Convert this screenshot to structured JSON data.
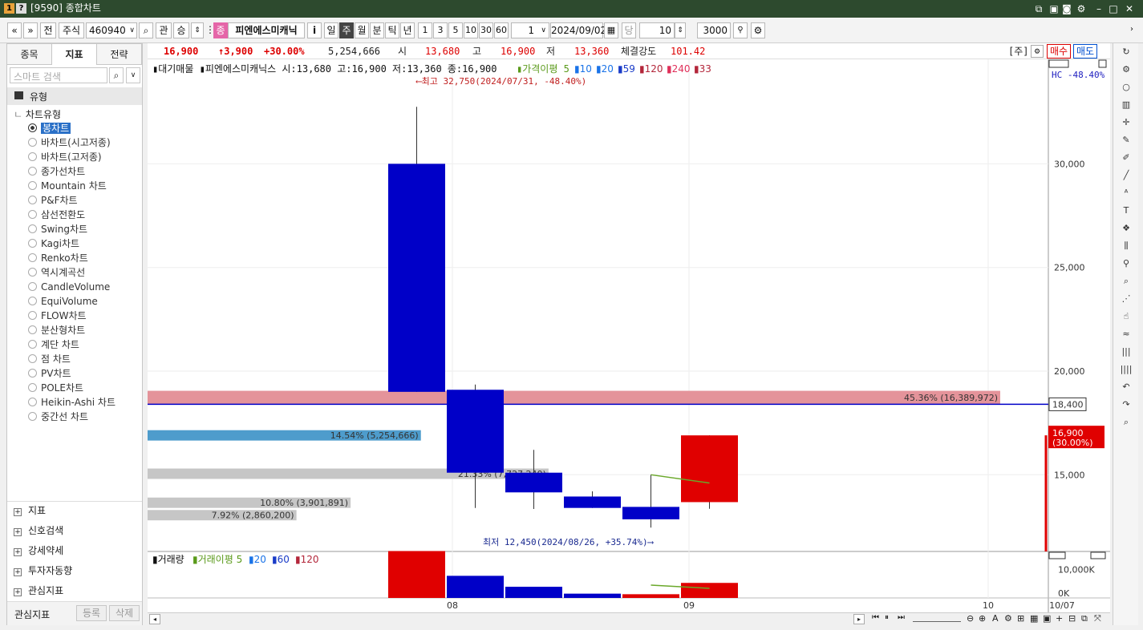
{
  "window": {
    "badge1": "1",
    "badge2": "?",
    "title": "[9590] 종합차트"
  },
  "toolbar": {
    "prev": "«",
    "next": "»",
    "jeon": "전",
    "market": "주식",
    "code": "460940",
    "search_icon": "search-icon",
    "gwan": "관",
    "seung": "승",
    "name_tag": "종",
    "name": "피엔에스미캐닉",
    "info": "i",
    "periods": [
      "일",
      "주",
      "월",
      "분",
      "틱",
      "년"
    ],
    "active_period": "주",
    "intervals": [
      "1",
      "3",
      "5",
      "10",
      "30",
      "60"
    ],
    "unit_value": "1",
    "date": "2024/09/02",
    "dang": "당",
    "count": "10",
    "slash": "/",
    "total": "3000"
  },
  "left_panel": {
    "tabs": [
      "종목",
      "지표",
      "전략"
    ],
    "active_tab": "지표",
    "search_placeholder": "스마트 검색",
    "section": "유형",
    "group": "차트유형",
    "chart_types": [
      "봉차트",
      "바차트(시고저종)",
      "바차트(고저종)",
      "종가선차트",
      "Mountain 차트",
      "P&F차트",
      "삼선전환도",
      "Swing차트",
      "Kagi차트",
      "Renko차트",
      "역시계곡선",
      "CandleVolume",
      "EquiVolume",
      "FLOW차트",
      "분산형차트",
      "계단 차트",
      "점 차트",
      "PV차트",
      "POLE차트",
      "Heikin-Ashi 차트",
      "중간선 차트"
    ],
    "selected_type": "봉차트",
    "tree_sections": [
      "지표",
      "신호검색",
      "강세약세",
      "투자자동향",
      "관심지표"
    ],
    "bottom_label": "관심지표",
    "register": "등록",
    "delete": "삭제"
  },
  "info_bar": {
    "price": "16,900",
    "change": "↑3,900",
    "change_pct": "+30.00%",
    "volume": "5,254,666",
    "open_label": "시",
    "open": "13,680",
    "high_label": "고",
    "high": "16,900",
    "low_label": "저",
    "low": "13,360",
    "strength_label": "체결강도",
    "strength": "101.42",
    "ju": "[주]",
    "buy": "매수",
    "sell": "매도"
  },
  "chart_header": {
    "prefix": "▮대기매물 ▮피엔에스미캐닉스 시:13,680 고:16,900 저:13,360 종:16,900",
    "ma_label": "▮가격이평 5",
    "ma_items": [
      {
        "label": "▮10",
        "color": "#1a73e8"
      },
      {
        "label": "▮20",
        "color": "#1a73e8"
      },
      {
        "label": "▮59",
        "color": "#1a3cc8"
      },
      {
        "label": "▮120",
        "color": "#b3263a"
      },
      {
        "label": "▮240",
        "color": "#e0305a"
      },
      {
        "label": "▮33",
        "color": "#b3263a"
      }
    ],
    "hc": "HC -48.40%",
    "max_annot": "⟵최고 32,750(2024/07/31, -48.40%)",
    "min_annot": "최저 12,450(2024/08/26, +35.74%)⟶",
    "last_price_box": "18,400",
    "current_price": "16,900",
    "current_pct": "(30.00%)"
  },
  "volume_header": {
    "label": "▮거래량",
    "ma_label": "▮거래이평 5",
    "items": [
      {
        "label": "▮20",
        "color": "#1a73e8"
      },
      {
        "label": "▮60",
        "color": "#1a3cc8"
      },
      {
        "label": "▮120",
        "color": "#b3263a"
      }
    ]
  },
  "chart_data": {
    "type": "candlestick",
    "ylim": [
      11300,
      34500
    ],
    "y_ticks": [
      15000,
      20000,
      25000,
      30000
    ],
    "y_tick_labels": [
      "15,000",
      "20,000",
      "25,000",
      "30,000"
    ],
    "x_labels": [
      "08",
      "09",
      "10",
      "10/07"
    ],
    "candles": [
      {
        "o": 19000,
        "h": 32750,
        "l": 19000,
        "c": 30000,
        "color": "blue"
      },
      {
        "o": 19100,
        "h": 19350,
        "l": 13400,
        "c": 15100,
        "color": "blue"
      },
      {
        "o": 15100,
        "h": 16200,
        "l": 13350,
        "c": 14150,
        "color": "blue"
      },
      {
        "o": 13950,
        "h": 14200,
        "l": 13400,
        "c": 13400,
        "color": "blue"
      },
      {
        "o": 13450,
        "h": 15000,
        "l": 12450,
        "c": 12850,
        "color": "blue"
      },
      {
        "o": 13680,
        "h": 16900,
        "l": 13360,
        "c": 16900,
        "color": "red"
      }
    ],
    "ma5": [
      15000,
      14600
    ],
    "volume_profile": [
      {
        "low": 18400,
        "high": 19050,
        "label": "45.36% (16,389,972)",
        "pct": 45.36,
        "color": "#e4939a"
      },
      {
        "low": 16650,
        "high": 17150,
        "label": "14.54% (5,254,666)",
        "pct": 14.54,
        "color": "#4e9ccc"
      },
      {
        "low": 14800,
        "high": 15300,
        "label": "21.33% (7,727,240)",
        "pct": 21.33,
        "color": "#c6c6c6"
      },
      {
        "low": 13400,
        "high": 13900,
        "label": "10.80% (3,901,891)",
        "pct": 10.8,
        "color": "#c6c6c6"
      },
      {
        "low": 12800,
        "high": 13300,
        "label": "7.92% (2,860,200)",
        "pct": 7.92,
        "color": "#c6c6c6"
      }
    ],
    "last_price_line": 18400,
    "volume": {
      "ylim": [
        0,
        14000
      ],
      "y_ticks": [
        0,
        10000
      ],
      "y_tick_labels": [
        "0K",
        "10,000K"
      ],
      "values": [
        16389,
        7727,
        3901,
        1500,
        1300,
        5254
      ],
      "colors": [
        "red",
        "blue",
        "blue",
        "blue",
        "red",
        "red"
      ]
    }
  },
  "colors": {
    "up": "#e00000",
    "down": "#0000c8",
    "title_bg": "#2d4a2e",
    "accent": "#2a70c7"
  }
}
